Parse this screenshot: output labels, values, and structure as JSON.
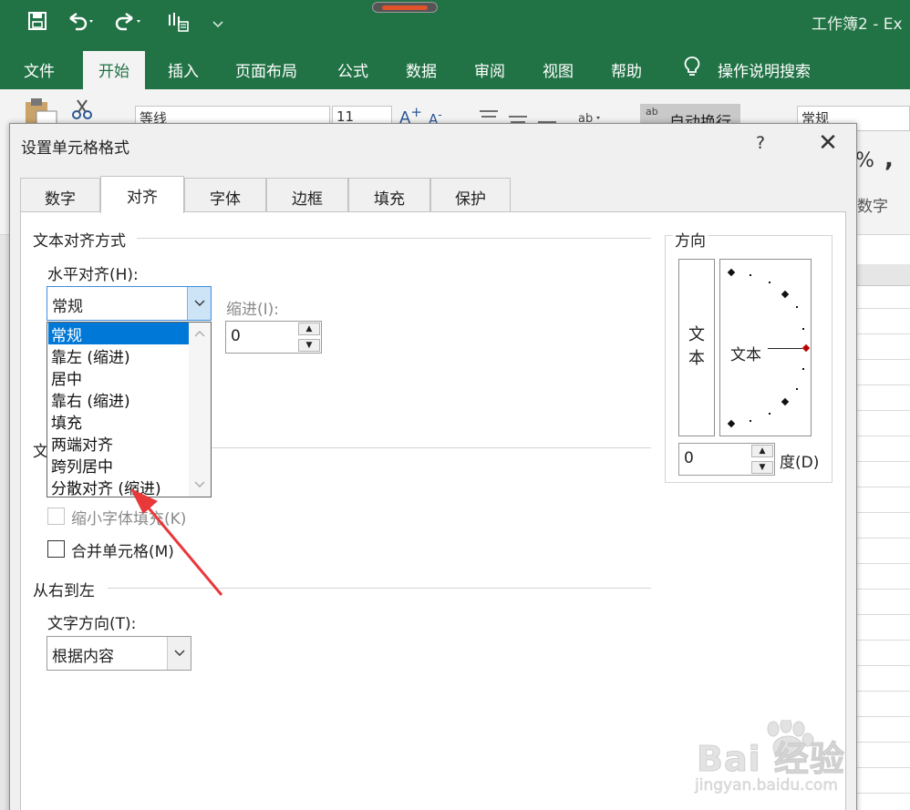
{
  "app": {
    "doc_title": "工作簿2  -  Ex",
    "qat": {
      "save_icon": "save-icon",
      "undo_icon": "undo-icon",
      "redo_icon": "redo-icon",
      "touch_icon": "touch-mode-icon",
      "more_icon": "customize-qat-icon"
    }
  },
  "ribbon": {
    "tabs": [
      "文件",
      "开始",
      "插入",
      "页面布局",
      "公式",
      "数据",
      "审阅",
      "视图",
      "帮助"
    ],
    "active_tab": "开始",
    "tell_me": "操作说明搜索",
    "font_name": "等线",
    "font_size": "11",
    "wrap_text": "自动换行",
    "number_format": "常规",
    "number_group": "数字",
    "percent": "%",
    "comma": ","
  },
  "dialog": {
    "title": "设置单元格格式",
    "help": "?",
    "close": "✕",
    "tabs": [
      "数字",
      "对齐",
      "字体",
      "边框",
      "填充",
      "保护"
    ],
    "active_tab": "对齐",
    "text_alignment": {
      "section": "文本对齐方式",
      "horizontal_label": "水平对齐(H):",
      "horizontal_value": "常规",
      "indent_label": "缩进(I):",
      "indent_value": "0",
      "horizontal_options": [
        "常规",
        "靠左 (缩进)",
        "居中",
        "靠右 (缩进)",
        "填充",
        "两端对齐",
        "跨列居中",
        "分散对齐 (缩进)"
      ],
      "selected_option": "常规"
    },
    "text_control": {
      "section_partial": "文",
      "shrink_label": "缩小字体填充(K)",
      "shrink_checked": false,
      "shrink_enabled": false,
      "merge_label": "合并单元格(M)",
      "merge_checked": false
    },
    "rtl": {
      "section": "从右到左",
      "direction_label": "文字方向(T):",
      "direction_value": "根据内容"
    },
    "orientation": {
      "section": "方向",
      "vertical_text_1": "文",
      "vertical_text_2": "本",
      "gauge_text": "文本",
      "degrees_value": "0",
      "degrees_label": "度(D)"
    }
  },
  "colors": {
    "excel_green": "#217346",
    "selection_blue": "#0078d7",
    "annotation_red": "#e8383a"
  },
  "watermark": {
    "text": "Bai 经验",
    "url_text": "jingyan.baidu.com"
  }
}
